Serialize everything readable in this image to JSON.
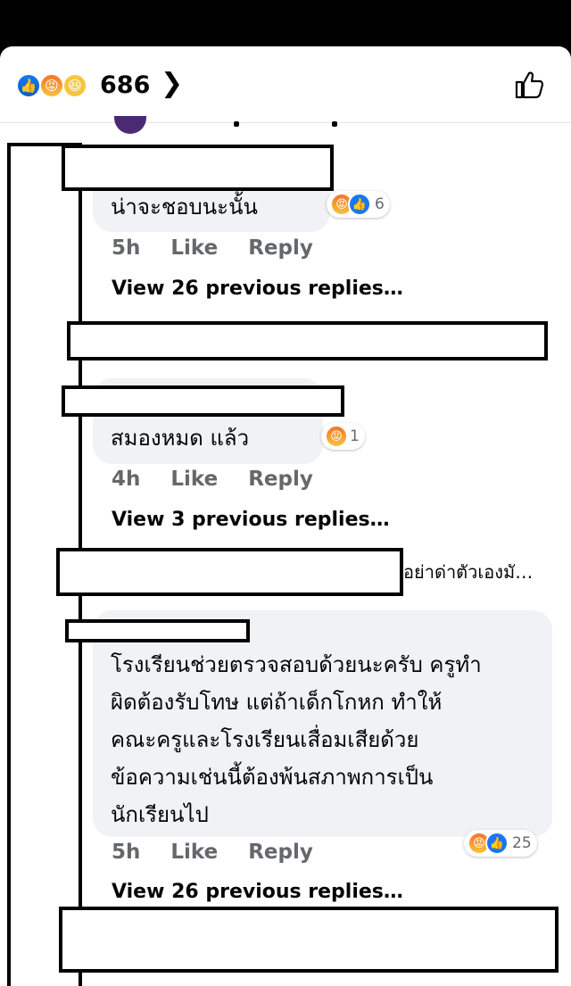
{
  "reactions": {
    "icons": [
      "like-icon",
      "angry-icon",
      "haha-icon"
    ],
    "total": "686"
  },
  "comments": [
    {
      "text": "น่าจะชอบนะนั้น",
      "time": "5h",
      "like": "Like",
      "reply": "Reply",
      "reaction_count": "6",
      "view_replies": "View 26 previous replies…"
    },
    {
      "text": "สมองหมด แล้ว",
      "time": "4h",
      "like": "Like",
      "reply": "Reply",
      "reaction_count": "1",
      "view_replies": "View 3 previous replies…"
    },
    {
      "snippet": "อย่าด่าตัวเองมั…"
    },
    {
      "text_lines": [
        "โรงเรียนช่วยตรวจสอบด้วยนะครับ ครูทำ",
        "ผิดต้องรับโทษ แต่ถ้าเด็กโกหก ทำให้",
        "คณะครูและโรงเรียนเสื่อมเสียด้วย",
        "ข้อความเช่นนี้ต้องพ้นสภาพการเป็น",
        "นักเรียนไป"
      ],
      "time": "5h",
      "like": "Like",
      "reply": "Reply",
      "reaction_count": "25",
      "view_replies": "View 26 previous replies…"
    }
  ],
  "colors": {
    "like_blue": "#1877f2",
    "angry_orange": "#f4752a",
    "meta_gray": "#65676b",
    "bubble_gray": "#f0f2f5"
  }
}
